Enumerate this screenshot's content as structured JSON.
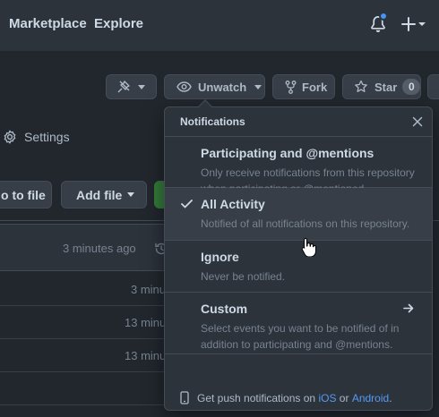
{
  "header": {
    "nav": [
      {
        "label": "Marketplace"
      },
      {
        "label": "Explore"
      }
    ]
  },
  "repo": {
    "watch_label": "Unwatch",
    "fork_label": "Fork",
    "star_label": "Star",
    "star_count": "0",
    "settings_label": "Settings",
    "goto_file_label": "o to file",
    "add_file_label": "Add file"
  },
  "files": {
    "latest_commit_time": "3 minutes ago",
    "rows": [
      {
        "time": "3 minu"
      },
      {
        "time": "13 minu"
      },
      {
        "time": "13 minu"
      }
    ]
  },
  "notifications_menu": {
    "title": "Notifications",
    "options": [
      {
        "title": "Participating and @mentions",
        "desc_line1": "Only receive notifications from this repository",
        "desc_line2": "when participating or @mentioned.",
        "selected": false
      },
      {
        "title": "All Activity",
        "desc_line1": "Notified of all notifications on this repository.",
        "selected": true
      },
      {
        "title": "Ignore",
        "desc_line1": "Never be notified.",
        "selected": false
      },
      {
        "title": "Custom",
        "desc_line1": "Select events you want to be notified of in",
        "desc_line2": "addition to participating and @mentions.",
        "selected": false
      }
    ],
    "footer": {
      "prefix": "Get push notifications on",
      "ios": "iOS",
      "or": "or",
      "android": "Android",
      "suffix": "."
    }
  },
  "colors": {
    "background": "#22272e",
    "accent_blue": "#539bf5",
    "green": "#347d39"
  }
}
